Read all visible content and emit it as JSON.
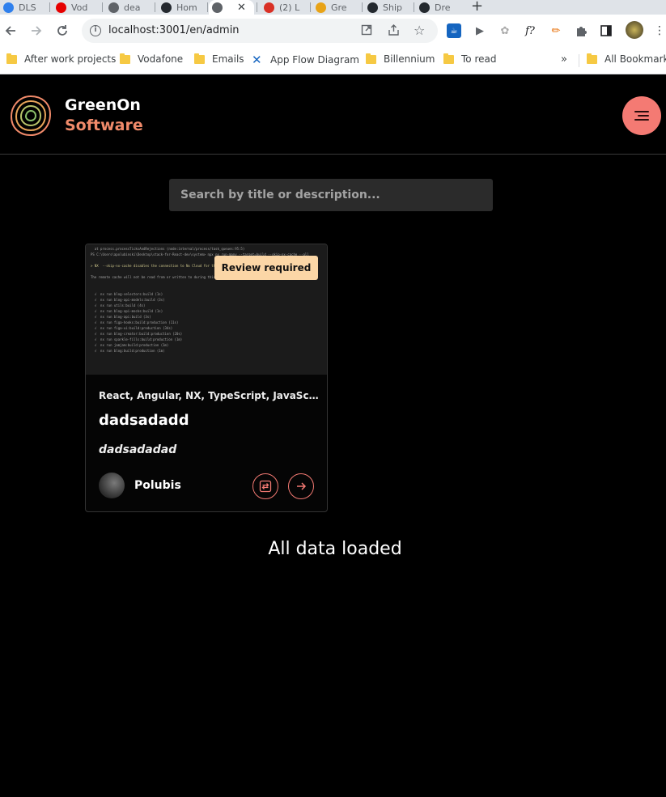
{
  "browser": {
    "tabs": [
      {
        "label": "DLS",
        "favicon_color": "#2f80ed"
      },
      {
        "label": "Vod",
        "favicon_color": "#e60000"
      },
      {
        "label": "dea",
        "favicon_color": "#5f6368"
      },
      {
        "label": "Hom",
        "favicon_color": "#24292f"
      },
      {
        "label": "",
        "favicon_color": "#5f6368"
      },
      {
        "label": "(2) L",
        "favicon_color": "#d93025"
      },
      {
        "label": "Gre",
        "favicon_color": "#e8a317"
      },
      {
        "label": "Ship",
        "favicon_color": "#24292f"
      },
      {
        "label": "Dre",
        "favicon_color": "#24292f"
      }
    ],
    "url": "localhost:3001/en/admin",
    "bookmarks": [
      "After work projects",
      "Vodafone",
      "Emails",
      "App Flow Diagram",
      "Billennium",
      "To read"
    ],
    "all_bookmarks_label": "All Bookmarks",
    "more_label": "»"
  },
  "app": {
    "brand_line1": "GreenOn",
    "brand_line2": "Software",
    "accent_color": "#f47a73",
    "search": {
      "placeholder": "Search by title or description..."
    },
    "card": {
      "badge": "Review required",
      "tags": "React, Angular, NX, TypeScript, JavaScript, …",
      "title": "dadsadadd",
      "description": "dadsadadad",
      "author": "Polubis",
      "thumbnail_lines": [
        "  at process.processTicksAndRejections (node:internal/process/task_queues:95:5)",
        "PS C:\\Users\\apolubinski\\Desktop\\stack-for-React-dev\\system> npx nx run-many --target=build --skip-nx-cache --all",
        "",
        "> NX  --skip-nx-cache disables the connection to Nx Cloud for the current run.",
        "",
        "The remote cache will not be read from or written to during this run.",
        "",
        "",
        "  √  nx run blog-selectors:build (1s)",
        "  √  nx run blog-api-models:build (3s)",
        "  √  nx run utils:build (4s)",
        "  √  nx run blog-api-mocks:build (1s)",
        "  √  nx run blog-api:build (3s)",
        "  √  nx run figa-hooks:build:production (11s)",
        "  √  nx run figa-ui:build:production (34s)",
        "  √  nx run blog-creator:build:production (20s)",
        "  √  nx run sparkle-fills:build:production (1m)",
        "  √  nx run jamjam:build:production (1m)",
        "  √  nx run blog:build:production (1m)"
      ]
    },
    "status_text": "All data loaded"
  }
}
